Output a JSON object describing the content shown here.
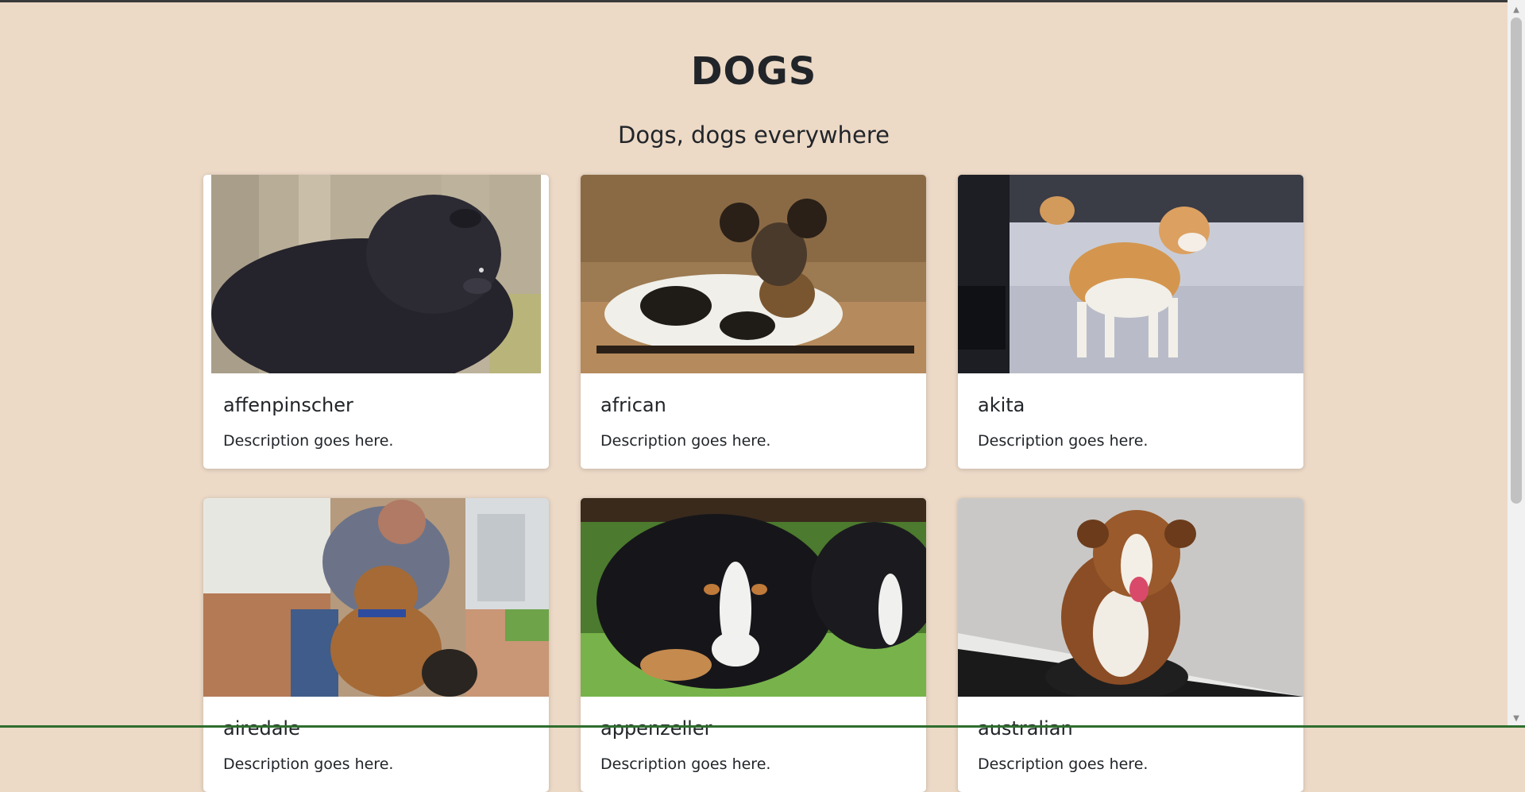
{
  "header": {
    "title": "DOGS",
    "subtitle": "Dogs, dogs everywhere"
  },
  "cards": [
    {
      "title": "affenpinscher",
      "text": "Description goes here.",
      "image": "affenpinscher-photo"
    },
    {
      "title": "african",
      "text": "Description goes here.",
      "image": "african-wild-dog-photo"
    },
    {
      "title": "akita",
      "text": "Description goes here.",
      "image": "akita-photo"
    },
    {
      "title": "airedale",
      "text": "Description goes here.",
      "image": "airedale-photo"
    },
    {
      "title": "appenzeller",
      "text": "Description goes here.",
      "image": "appenzeller-photo"
    },
    {
      "title": "australian",
      "text": "Description goes here.",
      "image": "australian-shepherd-photo"
    }
  ],
  "colors": {
    "background": "#ecd9c6",
    "card": "#ffffff",
    "text": "#212529"
  }
}
